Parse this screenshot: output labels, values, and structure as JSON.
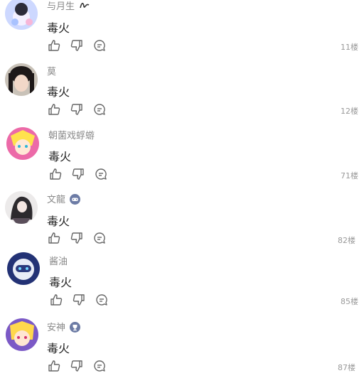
{
  "comments": [
    {
      "username": "与月生",
      "content": "毒火",
      "floor": "11楼",
      "badge": "signature-badge",
      "avatar_color": "#b9c7f5"
    },
    {
      "username": "莫",
      "content": "毒火",
      "floor": "12楼",
      "badge": "",
      "avatar_color": "#3a3030"
    },
    {
      "username": "朝菌戏蜉蝣",
      "content": "毒火",
      "floor": "71楼",
      "badge": "",
      "avatar_color": "#ec6aa8"
    },
    {
      "username": "文龍",
      "content": "毒火",
      "floor": "82楼",
      "badge": "gamepad-badge",
      "avatar_color": "#6f6f76"
    },
    {
      "username": "酱油",
      "content": "毒火",
      "floor": "85楼",
      "badge": "",
      "avatar_color": "#2f3e85"
    },
    {
      "username": "安神",
      "content": "毒火",
      "floor": "87楼",
      "badge": "trophy-badge",
      "avatar_color": "#7b59c6"
    }
  ],
  "colors": {
    "username": "#8a8a8a",
    "content": "#222222",
    "icon": "#666666",
    "floor": "#999999"
  },
  "icons": [
    "like-icon",
    "dislike-icon",
    "reply-icon"
  ]
}
